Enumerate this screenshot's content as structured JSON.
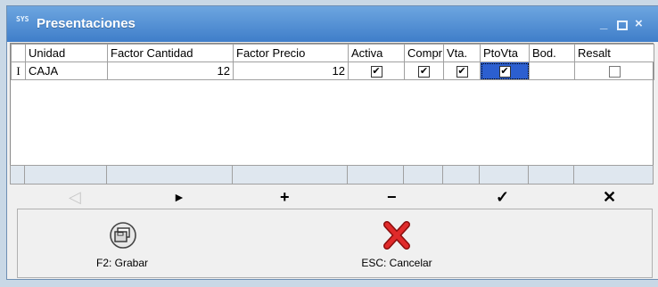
{
  "window": {
    "title": "Presentaciones",
    "icon": "syp-app-icon",
    "icon_text": "SYS"
  },
  "grid": {
    "columns": [
      "Unidad",
      "Factor Cantidad",
      "Factor Precio",
      "Activa",
      "Compr",
      "Vta.",
      "PtoVta",
      "Bod.",
      "Resalt"
    ],
    "rows": [
      {
        "unidad": "CAJA",
        "factor_cantidad": "12",
        "factor_precio": "12",
        "activa": true,
        "compr": true,
        "vta": true,
        "ptovta": true,
        "bod": null,
        "resalt": false
      }
    ],
    "row_indicator": "I"
  },
  "navigator": {
    "prior": "◁",
    "next": "►",
    "insert": "+",
    "delete": "−",
    "post": "✓",
    "cancel": "✕"
  },
  "actions": {
    "save_label": "F2: Grabar",
    "cancel_label": "ESC: Cancelar"
  },
  "colors": {
    "titlebar": "#4a8ad4",
    "selection": "#2c5fd0",
    "cancel_icon": "#d31e1e"
  }
}
